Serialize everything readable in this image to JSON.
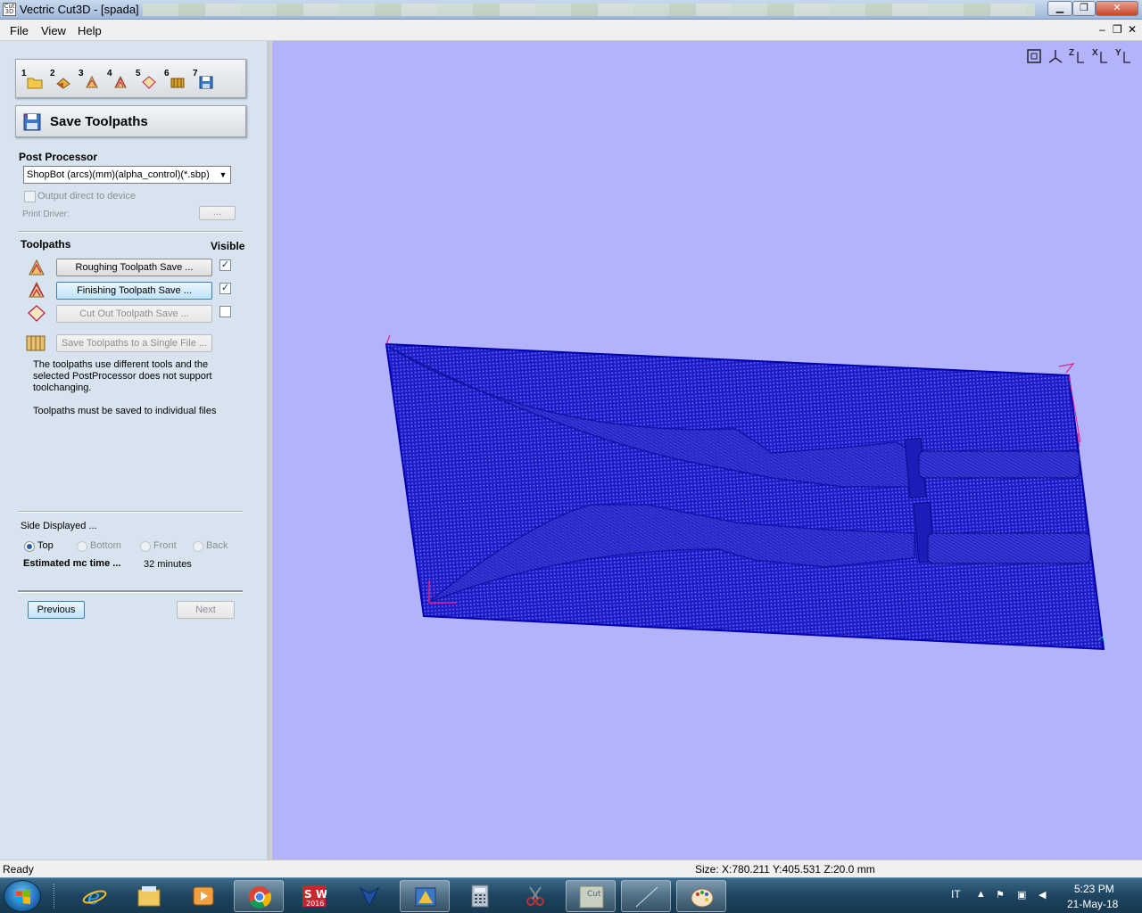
{
  "window": {
    "title": "Vectric Cut3D - [spada]",
    "icon_label": "Cut 3D"
  },
  "menu": {
    "items": [
      "File",
      "View",
      "Help"
    ]
  },
  "toolbar": {
    "steps": [
      "1",
      "2",
      "3",
      "4",
      "5",
      "6",
      "7"
    ]
  },
  "panel": {
    "title": "Save Toolpaths",
    "post_processor_label": "Post Processor",
    "post_processor_value": "ShopBot (arcs)(mm)(alpha_control)(*.sbp)",
    "output_direct_label": "Output direct to device",
    "print_driver_label": "Print Driver:",
    "print_driver_button": "...",
    "toolpaths_label": "Toolpaths",
    "visible_label": "Visible",
    "toolpaths": [
      {
        "label": "Roughing Toolpath Save ...",
        "visible": true,
        "enabled": true,
        "active": false
      },
      {
        "label": "Finishing Toolpath Save ...",
        "visible": true,
        "enabled": true,
        "active": true
      },
      {
        "label": "Cut Out Toolpath Save ...",
        "visible": false,
        "enabled": false,
        "active": false
      }
    ],
    "single_file_button": "Save Toolpaths to a Single File ...",
    "info_line1": "The toolpaths use different tools and the selected PostProcessor does not support toolchanging.",
    "info_line2": "Toolpaths must be saved to individual files",
    "side_displayed_label": "Side Displayed ...",
    "sides": [
      {
        "label": "Top",
        "checked": true
      },
      {
        "label": "Bottom",
        "checked": false
      },
      {
        "label": "Front",
        "checked": false
      },
      {
        "label": "Back",
        "checked": false
      }
    ],
    "estimated_label": "Estimated mc time ...",
    "estimated_value": "32 minutes",
    "previous_button": "Previous",
    "next_button": "Next"
  },
  "viewport": {
    "background": "#b3b3fb",
    "mesh_color": "#1414c8",
    "view_icons": [
      "fit-view-icon",
      "iso-view-icon",
      "view-z-icon",
      "view-x-icon",
      "view-y-icon"
    ],
    "view_icon_labels": [
      "",
      "",
      "Z",
      "X",
      "Y"
    ]
  },
  "status": {
    "text": "Ready",
    "size": "Size: X:780.211 Y:405.531 Z:20.0 mm"
  },
  "taskbar": {
    "lang": "IT",
    "time": "5:23 PM",
    "date": "21-May-18",
    "apps": [
      "internet-explorer-icon",
      "file-explorer-icon",
      "media-player-icon",
      "chrome-icon",
      "solidworks-icon",
      "vectric-icon",
      "cut3d-tool-icon",
      "calculator-icon",
      "snipping-icon",
      "cut3d-icon",
      "window-icon",
      "paint-icon"
    ],
    "sw_label": "S W",
    "sw_year": "2016",
    "cut3d_label": "Cut 3D"
  }
}
